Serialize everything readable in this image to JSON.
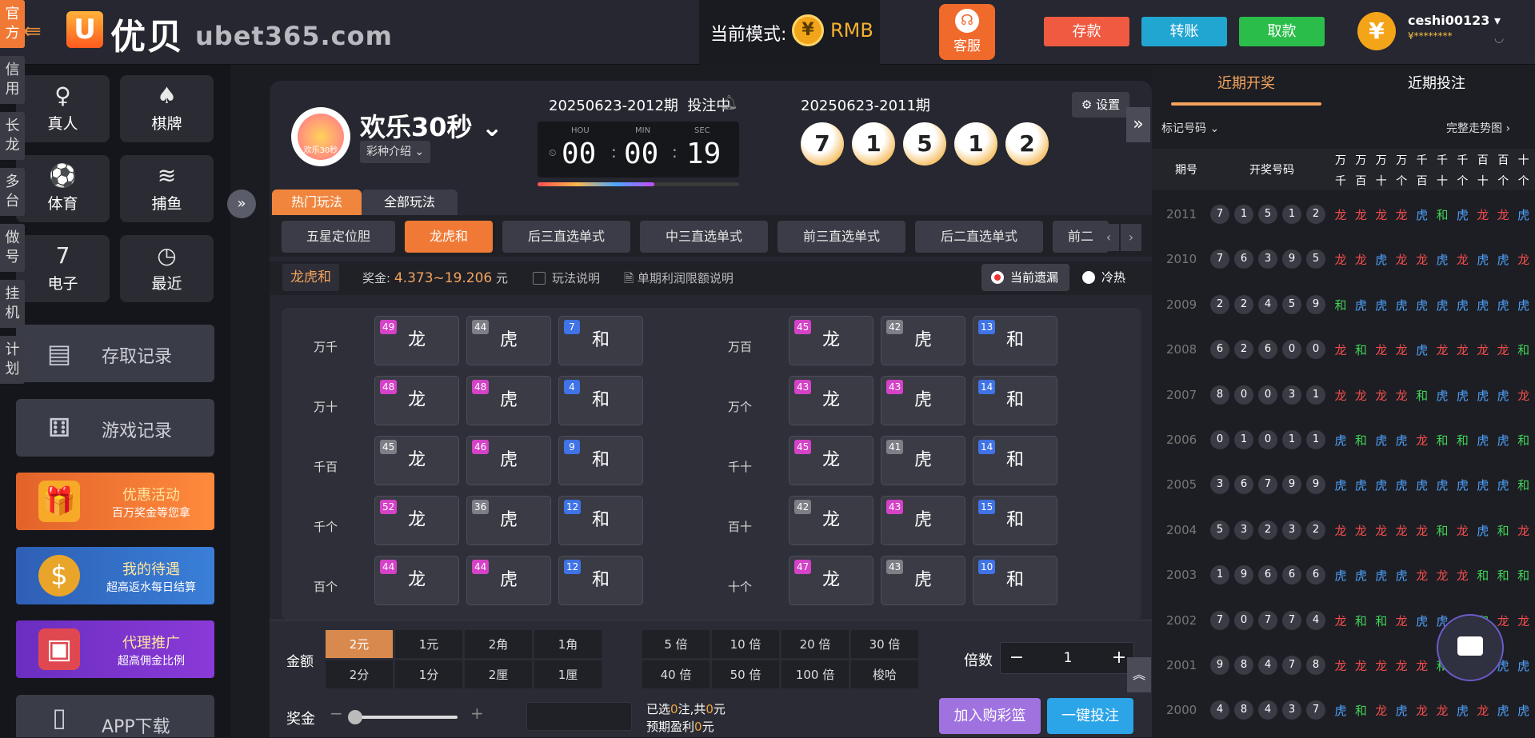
{
  "header": {
    "logo_mark": "U",
    "logo_cn": "优贝",
    "logo_en": "ubet365.com",
    "mode_label": "当前模式:",
    "mode_value": "RMB",
    "service_label": "客服",
    "deposit_label": "存款",
    "transfer_label": "转账",
    "withdraw_label": "取款",
    "username": "ceshi00123",
    "balance_mask": "¥********",
    "colors": {
      "deposit": "#ef5a41",
      "transfer": "#21a6d2",
      "withdraw": "#2bbd4a",
      "accent": "#f07a35"
    }
  },
  "sidebar": {
    "grid": [
      "真人",
      "棋牌",
      "体育",
      "捕鱼",
      "电子",
      "最近"
    ],
    "records": [
      "存取记录",
      "游戏记录"
    ],
    "promos": [
      {
        "title": "优惠活动",
        "sub": "百万奖金等您拿"
      },
      {
        "title": "我的待遇",
        "sub": "超高返水每日结算"
      },
      {
        "title": "代理推广",
        "sub": "超高佣金比例"
      }
    ],
    "app_download": "APP下载"
  },
  "vertical_tabs": [
    "官方",
    "信用",
    "长龙",
    "多台",
    "做号",
    "挂机",
    "计划"
  ],
  "game": {
    "title": "欢乐30秒",
    "intro": "彩种介绍",
    "icon_text": "欢乐30秒",
    "current_period": "20250623-2012期",
    "current_status": "投注中",
    "timer": {
      "hou_label": "HOU",
      "min_label": "MIN",
      "sec_label": "SEC",
      "hou": "00",
      "min": "00",
      "sec": "19",
      "progress": 0.58
    },
    "last_period": "20250623-2011期",
    "last_numbers": [
      "7",
      "1",
      "5",
      "1",
      "2"
    ],
    "settings": "设置"
  },
  "play_tabs": {
    "hot": "热门玩法",
    "all": "全部玩法"
  },
  "plays": [
    "五星定位胆",
    "龙虎和",
    "后三直选单式",
    "中三直选单式",
    "前三直选单式",
    "后二直选单式",
    "前二"
  ],
  "info": {
    "name": "龙虎和",
    "prize_label": "奖金:",
    "prize_value": "4.373~19.206",
    "prize_unit": "元",
    "rules": "玩法说明",
    "limit": "单期利润限额说明",
    "missing": "当前遗漏",
    "hotcold": "冷热"
  },
  "board": {
    "left": [
      {
        "label": "万千",
        "cells": [
          [
            "龙",
            "49",
            "pink"
          ],
          [
            "虎",
            "44",
            "gray"
          ],
          [
            "和",
            "7",
            "blue"
          ]
        ]
      },
      {
        "label": "万十",
        "cells": [
          [
            "龙",
            "48",
            "pink"
          ],
          [
            "虎",
            "48",
            "pink"
          ],
          [
            "和",
            "4",
            "blue"
          ]
        ]
      },
      {
        "label": "千百",
        "cells": [
          [
            "龙",
            "45",
            "gray"
          ],
          [
            "虎",
            "46",
            "pink"
          ],
          [
            "和",
            "9",
            "blue"
          ]
        ]
      },
      {
        "label": "千个",
        "cells": [
          [
            "龙",
            "52",
            "pink"
          ],
          [
            "虎",
            "36",
            "gray"
          ],
          [
            "和",
            "12",
            "blue"
          ]
        ]
      },
      {
        "label": "百个",
        "cells": [
          [
            "龙",
            "44",
            "pink"
          ],
          [
            "虎",
            "44",
            "pink"
          ],
          [
            "和",
            "12",
            "blue"
          ]
        ]
      }
    ],
    "right": [
      {
        "label": "万百",
        "cells": [
          [
            "龙",
            "45",
            "pink"
          ],
          [
            "虎",
            "42",
            "gray"
          ],
          [
            "和",
            "13",
            "blue"
          ]
        ]
      },
      {
        "label": "万个",
        "cells": [
          [
            "龙",
            "43",
            "pink"
          ],
          [
            "虎",
            "43",
            "pink"
          ],
          [
            "和",
            "14",
            "blue"
          ]
        ]
      },
      {
        "label": "千十",
        "cells": [
          [
            "龙",
            "45",
            "pink"
          ],
          [
            "虎",
            "41",
            "gray"
          ],
          [
            "和",
            "14",
            "blue"
          ]
        ]
      },
      {
        "label": "百十",
        "cells": [
          [
            "龙",
            "42",
            "gray"
          ],
          [
            "虎",
            "43",
            "pink"
          ],
          [
            "和",
            "15",
            "blue"
          ]
        ]
      },
      {
        "label": "十个",
        "cells": [
          [
            "龙",
            "47",
            "pink"
          ],
          [
            "虎",
            "43",
            "gray"
          ],
          [
            "和",
            "10",
            "blue"
          ]
        ]
      }
    ]
  },
  "bet": {
    "amount_label": "金额",
    "amounts": [
      "2元",
      "1元",
      "2角",
      "1角",
      "2分",
      "1分",
      "2厘",
      "1厘"
    ],
    "multipliers": [
      "5 倍",
      "10 倍",
      "20 倍",
      "30 倍",
      "40 倍",
      "50 倍",
      "100 倍",
      "梭哈"
    ],
    "mult_label": "倍数",
    "mult_value": "1",
    "prize_label": "奖金",
    "selected_prefix": "已选",
    "selected_count": "0",
    "selected_mid": "注,共",
    "selected_amount": "0",
    "selected_unit": "元",
    "profit_label": "预期盈利",
    "profit_value": "0",
    "profit_unit": "元",
    "add_cart": "加入购彩篮",
    "quick_bet": "一键投注"
  },
  "right_panel": {
    "tab_recent_draw": "近期开奖",
    "tab_recent_bet": "近期投注",
    "mark_numbers": "标记号码",
    "full_trend": "完整走势图",
    "col_period": "期号",
    "col_numbers": "开奖号码",
    "col_pairs": [
      [
        "万",
        "千"
      ],
      [
        "万",
        "百"
      ],
      [
        "万",
        "十"
      ],
      [
        "万",
        "个"
      ],
      [
        "千",
        "百"
      ],
      [
        "千",
        "十"
      ],
      [
        "千",
        "个"
      ],
      [
        "百",
        "十"
      ],
      [
        "百",
        "个"
      ],
      [
        "十",
        "个"
      ]
    ],
    "rows": [
      {
        "period": "2011",
        "nums": [
          "7",
          "1",
          "5",
          "1",
          "2"
        ],
        "res": [
          "龙",
          "龙",
          "龙",
          "龙",
          "虎",
          "和",
          "虎",
          "龙",
          "龙",
          "虎"
        ]
      },
      {
        "period": "2010",
        "nums": [
          "7",
          "6",
          "3",
          "9",
          "5"
        ],
        "res": [
          "龙",
          "龙",
          "虎",
          "龙",
          "龙",
          "虎",
          "龙",
          "虎",
          "虎",
          "龙"
        ]
      },
      {
        "period": "2009",
        "nums": [
          "2",
          "2",
          "4",
          "5",
          "9"
        ],
        "res": [
          "和",
          "虎",
          "虎",
          "虎",
          "虎",
          "虎",
          "虎",
          "虎",
          "虎",
          "虎"
        ]
      },
      {
        "period": "2008",
        "nums": [
          "6",
          "2",
          "6",
          "0",
          "0"
        ],
        "res": [
          "龙",
          "和",
          "龙",
          "龙",
          "虎",
          "龙",
          "龙",
          "龙",
          "龙",
          "和"
        ]
      },
      {
        "period": "2007",
        "nums": [
          "8",
          "0",
          "0",
          "3",
          "1"
        ],
        "res": [
          "龙",
          "龙",
          "龙",
          "龙",
          "和",
          "虎",
          "虎",
          "虎",
          "虎",
          "龙"
        ]
      },
      {
        "period": "2006",
        "nums": [
          "0",
          "1",
          "0",
          "1",
          "1"
        ],
        "res": [
          "虎",
          "和",
          "虎",
          "虎",
          "龙",
          "和",
          "和",
          "虎",
          "虎",
          "和"
        ]
      },
      {
        "period": "2005",
        "nums": [
          "3",
          "6",
          "7",
          "9",
          "9"
        ],
        "res": [
          "虎",
          "虎",
          "虎",
          "虎",
          "虎",
          "虎",
          "虎",
          "虎",
          "虎",
          "和"
        ]
      },
      {
        "period": "2004",
        "nums": [
          "5",
          "3",
          "2",
          "3",
          "2"
        ],
        "res": [
          "龙",
          "龙",
          "龙",
          "龙",
          "龙",
          "和",
          "龙",
          "虎",
          "和",
          "龙"
        ]
      },
      {
        "period": "2003",
        "nums": [
          "1",
          "9",
          "6",
          "6",
          "6"
        ],
        "res": [
          "虎",
          "虎",
          "虎",
          "虎",
          "龙",
          "龙",
          "龙",
          "和",
          "和",
          "和"
        ]
      },
      {
        "period": "2002",
        "nums": [
          "7",
          "0",
          "7",
          "7",
          "4"
        ],
        "res": [
          "龙",
          "和",
          "和",
          "龙",
          "虎",
          "虎",
          "龙",
          "和",
          "龙",
          "龙"
        ]
      },
      {
        "period": "2001",
        "nums": [
          "9",
          "8",
          "4",
          "7",
          "8"
        ],
        "res": [
          "龙",
          "龙",
          "龙",
          "龙",
          "龙",
          "和",
          "龙",
          "虎",
          "虎",
          "虎"
        ]
      },
      {
        "period": "2000",
        "nums": [
          "4",
          "8",
          "4",
          "3",
          "7"
        ],
        "res": [
          "虎",
          "和",
          "龙",
          "虎",
          "龙",
          "龙",
          "虎",
          "龙",
          "虎",
          "虎"
        ]
      }
    ]
  }
}
